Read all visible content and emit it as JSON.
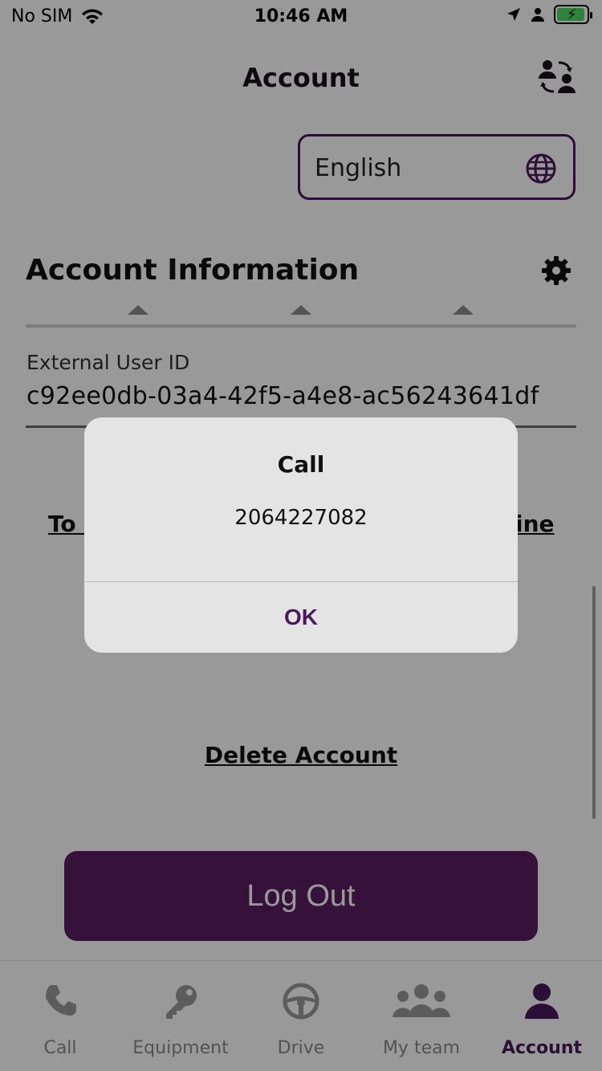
{
  "status_bar": {
    "carrier": "No SIM",
    "time": "10:46 AM"
  },
  "header": {
    "title": "Account"
  },
  "language_selector": {
    "value": "English"
  },
  "account_info": {
    "title": "Account Information",
    "field_label": "External User ID",
    "field_value": "c92ee0db-03a4-42f5-a4e8-ac56243641df"
  },
  "links": {
    "left_partial": "To a",
    "right_partial": "ine",
    "delete_account": "Delete Account"
  },
  "logout": {
    "label": "Log Out"
  },
  "tab_bar": {
    "items": [
      {
        "label": "Call",
        "icon": "phone-icon"
      },
      {
        "label": "Equipment",
        "icon": "key-icon"
      },
      {
        "label": "Drive",
        "icon": "steering-wheel-icon"
      },
      {
        "label": "My team",
        "icon": "team-icon"
      },
      {
        "label": "Account",
        "icon": "person-icon"
      }
    ],
    "active_index": 4
  },
  "dialog": {
    "title": "Call",
    "message": "2064227082",
    "ok_label": "OK"
  },
  "colors": {
    "brand": "#5a1f63",
    "brand_text": "#4a1a5c",
    "battery": "#4cd964"
  }
}
